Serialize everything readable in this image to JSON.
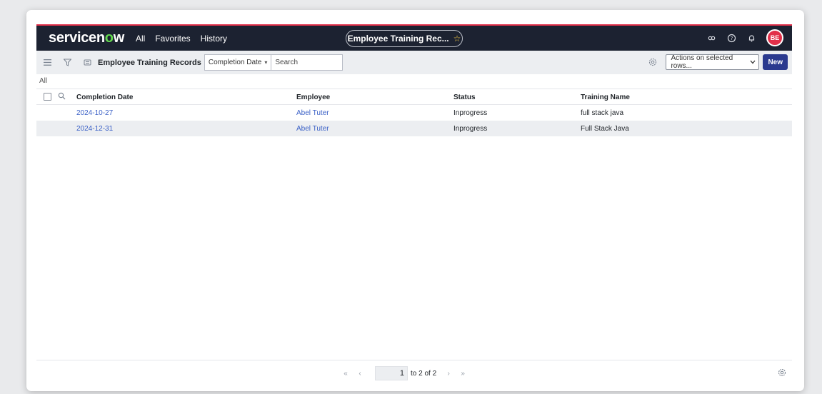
{
  "nav": {
    "logo_text_a": "servicen",
    "logo_text_o": "o",
    "logo_text_b": "w",
    "links": [
      "All",
      "Favorites",
      "History"
    ],
    "center_title": "Employee Training Rec...",
    "avatar_initials": "BE"
  },
  "toolbar": {
    "list_title": "Employee Training Records",
    "field_select": "Completion Date",
    "search_placeholder": "Search",
    "actions_label": "Actions on selected rows...",
    "new_label": "New"
  },
  "breadcrumb": "All",
  "table": {
    "columns": [
      "Completion Date",
      "Employee",
      "Status",
      "Training Name"
    ],
    "rows": [
      [
        "2024-10-27",
        "Abel Tuter",
        "Inprogress",
        "full stack java"
      ],
      [
        "2024-12-31",
        "Abel Tuter",
        "Inprogress",
        "Full Stack Java"
      ]
    ]
  },
  "pager": {
    "current": "1",
    "range_text": "to 2 of 2"
  },
  "colors": {
    "nav_bg": "#1c2231",
    "accent_red": "#e2304a",
    "logo_green": "#62d84e",
    "link_blue": "#3a60c6",
    "new_button": "#2b3a8f"
  }
}
